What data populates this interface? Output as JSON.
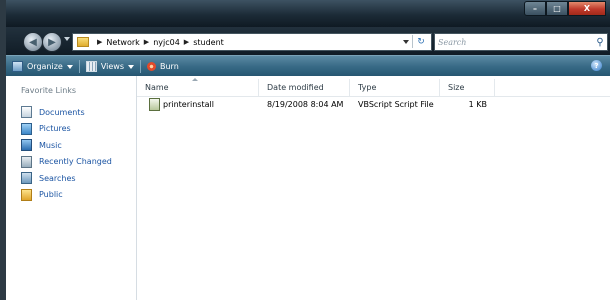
{
  "window": {
    "minimize_glyph": "–",
    "maximize_glyph": "□",
    "close_glyph": "X"
  },
  "address": {
    "crumbs": [
      "Network",
      "nyjc04",
      "student"
    ],
    "search_placeholder": "Search"
  },
  "toolbar": {
    "organize_label": "Organize",
    "views_label": "Views",
    "burn_label": "Burn",
    "help_glyph": "?"
  },
  "favorites": {
    "title": "Favorite Links",
    "items": [
      {
        "label": "Documents",
        "icon": "documents-icon"
      },
      {
        "label": "Pictures",
        "icon": "pictures-icon"
      },
      {
        "label": "Music",
        "icon": "music-icon"
      },
      {
        "label": "Recently Changed",
        "icon": "recently-changed-icon"
      },
      {
        "label": "Searches",
        "icon": "searches-icon"
      },
      {
        "label": "Public",
        "icon": "public-folder-icon"
      }
    ]
  },
  "file_list": {
    "columns": [
      "Name",
      "Date modified",
      "Type",
      "Size"
    ],
    "rows": [
      {
        "name": "printerinstall",
        "date": "8/19/2008 8:04 AM",
        "type": "VBScript Script File",
        "size": "1 KB"
      }
    ]
  }
}
